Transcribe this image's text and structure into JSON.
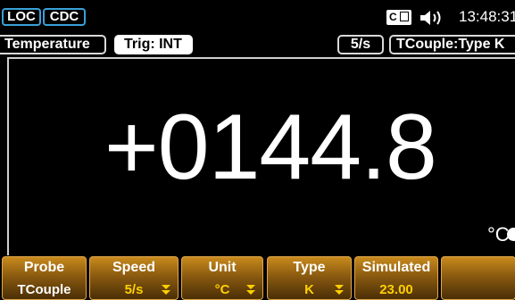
{
  "status_bar": {
    "loc_label": "LOC",
    "cdc_label": "CDC",
    "ce_icon": "ce-mark-icon",
    "speaker_icon": "speaker-icon",
    "time": "13:48:31"
  },
  "info_bar": {
    "function": "Temperature",
    "trigger": "Trig: INT",
    "rate": "5/s",
    "sensor": "TCouple:Type K"
  },
  "display": {
    "reading": "+0144.8",
    "unit": "°C"
  },
  "softkeys": [
    {
      "label": "Probe",
      "value": "TCouple"
    },
    {
      "label": "Speed",
      "value": "5/s"
    },
    {
      "label": "Unit",
      "value": "°C"
    },
    {
      "label": "Type",
      "value": "K"
    },
    {
      "label": "Simulated",
      "value": "23.00"
    },
    {
      "label": "",
      "value": ""
    }
  ],
  "colors": {
    "tag_border": "#3aa0d8",
    "softkey_value": "#ffd000",
    "softkey_bg": "#8a5a10",
    "softkey_border": "#e1a64a"
  }
}
